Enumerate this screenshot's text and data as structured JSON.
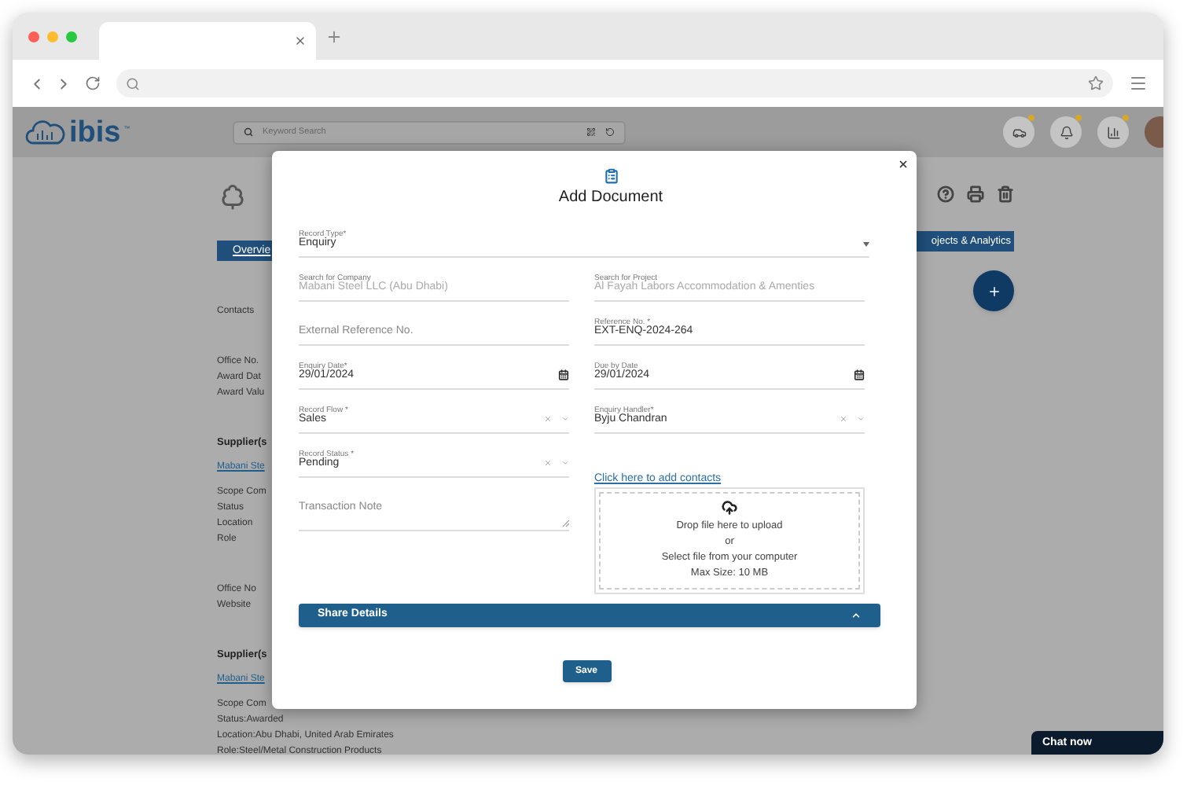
{
  "header": {
    "logo": "ibis",
    "logo_mark": "™",
    "search": {
      "placeholder": "Keyword Search"
    }
  },
  "background": {
    "overview_tab": {
      "label": "Overvie"
    },
    "analytics_tab": {
      "label": "ojects & Analytics"
    },
    "groups": [
      {
        "items": [
          {
            "kind": "label",
            "text": "Contacts"
          }
        ]
      },
      {
        "items": [
          {
            "kind": "field",
            "label": "Office No."
          },
          {
            "kind": "field",
            "label": "Award Dat"
          },
          {
            "kind": "field",
            "label": "Award Valu"
          }
        ]
      },
      {
        "items": [
          {
            "kind": "heading",
            "text": "Supplier(s"
          },
          {
            "kind": "link",
            "text": "Mabani Ste"
          },
          {
            "kind": "field",
            "label": "Scope Com"
          },
          {
            "kind": "field",
            "label": "Status"
          },
          {
            "kind": "field",
            "label": "Location"
          },
          {
            "kind": "field",
            "label": "Role"
          }
        ]
      },
      {
        "items": [
          {
            "kind": "field",
            "label": "Office No"
          },
          {
            "kind": "field",
            "label": "Website"
          }
        ]
      },
      {
        "items": [
          {
            "kind": "heading",
            "text": "Supplier(s"
          },
          {
            "kind": "link",
            "text": "Mabani Ste"
          },
          {
            "kind": "field",
            "label": "Scope Com"
          },
          {
            "kind": "field",
            "label": "Status",
            "colon": ":",
            "value": "Awarded"
          },
          {
            "kind": "field",
            "label": "Location",
            "colon": ":",
            "value": "Abu Dhabi, United Arab Emirates"
          },
          {
            "kind": "field",
            "label": "Role",
            "colon": ":",
            "value": "Steel/Metal Construction Products"
          }
        ]
      }
    ],
    "chat": {
      "label": "Chat now"
    }
  },
  "modal": {
    "title": "Add Document",
    "record_type": {
      "label": "Record Type*",
      "value": "Enquiry"
    },
    "fields": [
      {
        "kind": "text",
        "label": "Search for Company",
        "value": "Mabani Steel LLC (Abu Dhabi)",
        "disabled": true
      },
      {
        "kind": "text",
        "label": "Search for Project",
        "value": "Al Fayah Labors Accommodation & Amenties",
        "disabled": true
      },
      {
        "kind": "text",
        "placeholder": "External Reference No."
      },
      {
        "kind": "text",
        "label": "Reference No. *",
        "value": "EXT-ENQ-2024-264",
        "disabled": false
      },
      {
        "kind": "date",
        "label": "Enquiry Date*",
        "value": "29/01/2024",
        "disabled": false
      },
      {
        "kind": "date",
        "label": "Due by Date",
        "value": "29/01/2024",
        "disabled": false
      },
      {
        "kind": "select",
        "label": "Record Flow *",
        "value": "Sales",
        "disabled": false
      },
      {
        "kind": "select",
        "label": "Enquiry Handler*",
        "value": "Byju Chandran",
        "disabled": false
      },
      {
        "kind": "select",
        "label": "Record Status *",
        "value": "Pending",
        "disabled": false
      },
      {
        "kind": "link",
        "text": "Click here to add contacts"
      },
      {
        "kind": "textarea",
        "placeholder": "Transaction Note"
      },
      {
        "kind": "upload",
        "lines": [
          "Drop file here to upload",
          "or",
          "Select file from your computer",
          "Max Size: 10 MB"
        ]
      }
    ],
    "share": {
      "label": "Share Details",
      "expanded": true
    },
    "save": {
      "label": "Save"
    }
  }
}
